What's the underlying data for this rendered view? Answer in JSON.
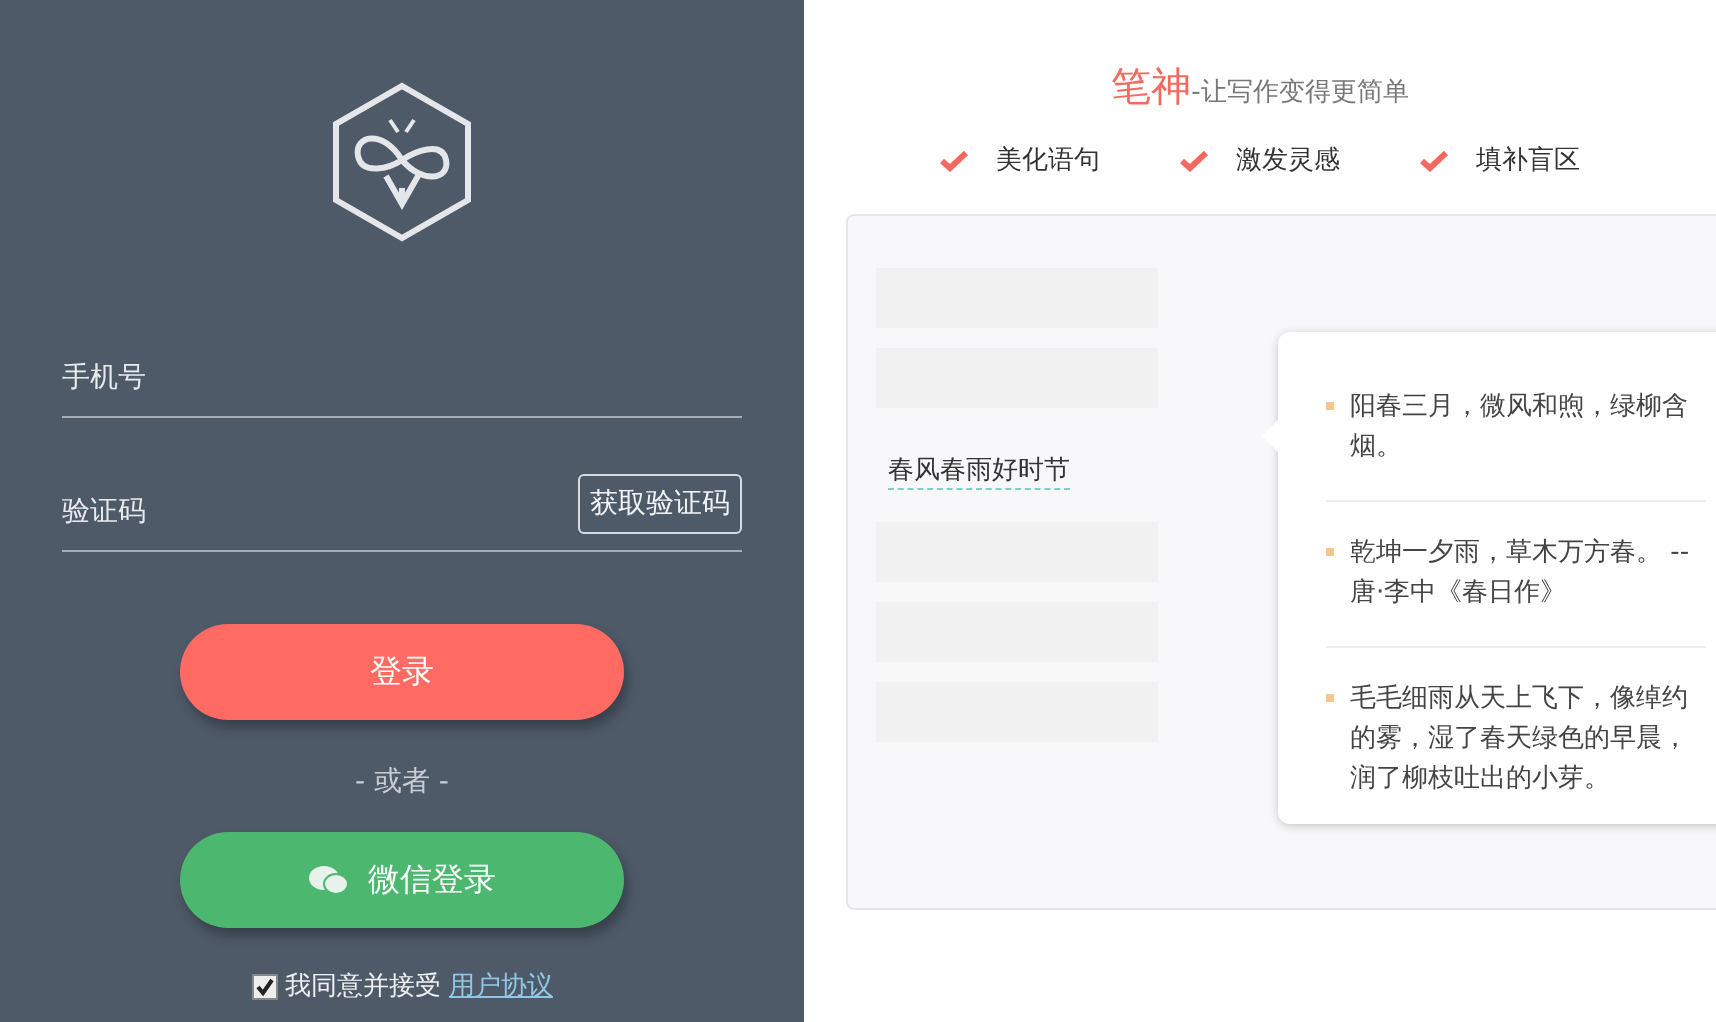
{
  "login": {
    "phone_field": {
      "placeholder": "手机号"
    },
    "code_field": {
      "placeholder": "验证码"
    },
    "get_code_button": "获取验证码",
    "login_button": "登录",
    "separator": "- 或者 -",
    "wechat_button": "微信登录",
    "agreement": {
      "checked": true,
      "text": "我同意并接受",
      "link": "用户协议"
    }
  },
  "intro": {
    "brand": "笔神",
    "tagline": "-让写作变得更简单",
    "features": [
      "美化语句",
      "激发灵感",
      "填补盲区"
    ]
  },
  "demo": {
    "lines": [
      {
        "kind": "placeholder"
      },
      {
        "kind": "placeholder"
      },
      {
        "kind": "text",
        "text": "春风春雨好时节"
      },
      {
        "kind": "placeholder"
      },
      {
        "kind": "placeholder"
      },
      {
        "kind": "placeholder"
      }
    ],
    "suggestions": [
      "阳春三月，微风和煦，绿柳含烟。",
      "乾坤一夕雨，草木万方春。 --唐·李中《春日作》",
      "毛毛细雨从天上飞下，像绰约的雾，湿了春天绿色的早晨，润了柳枝吐出的小芽。"
    ]
  }
}
